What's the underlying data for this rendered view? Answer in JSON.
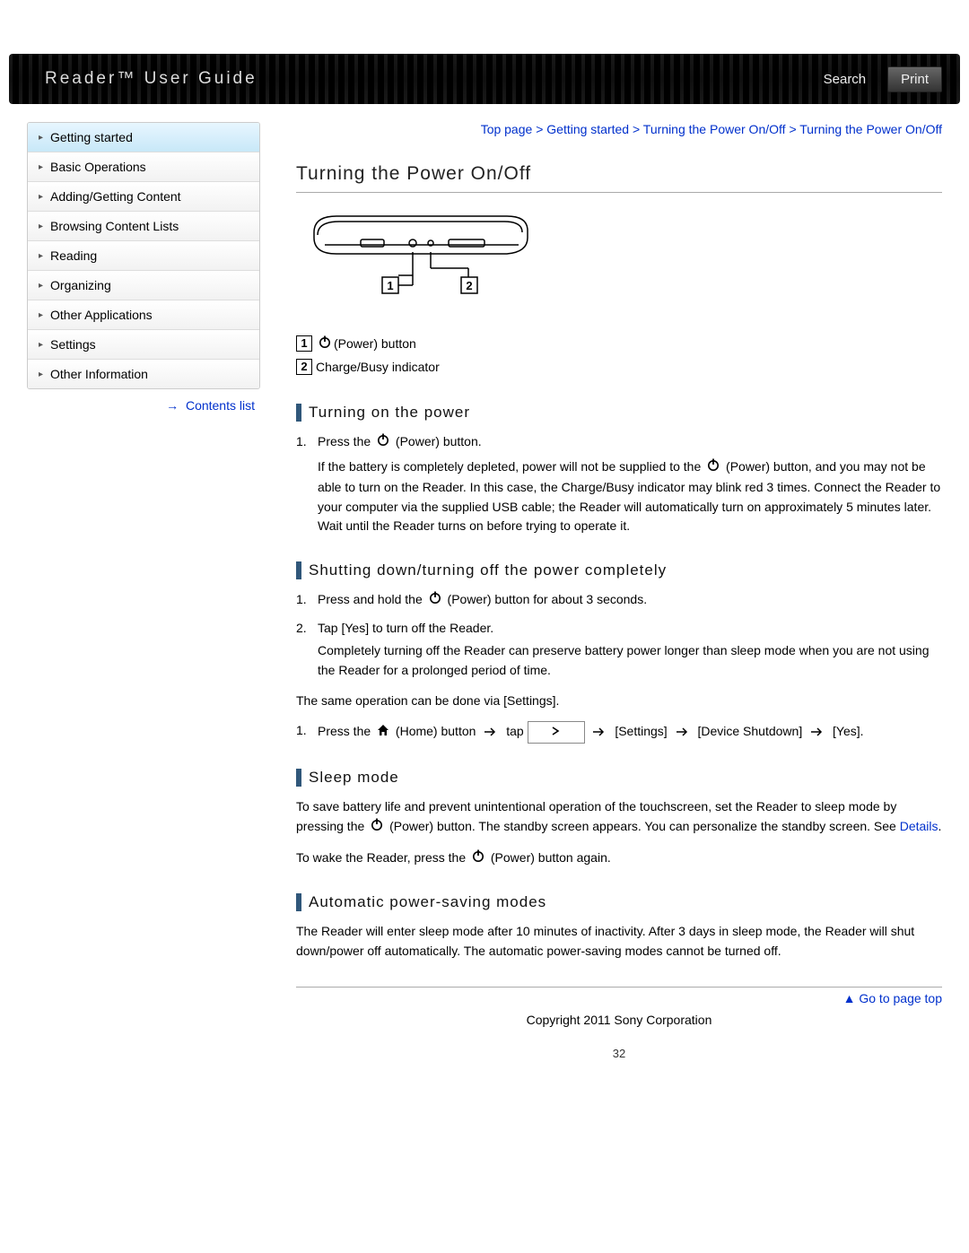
{
  "header": {
    "title": "Reader™ User Guide",
    "search_label": "Search",
    "print_label": "Print"
  },
  "sidebar": {
    "items": [
      {
        "label": "Getting started",
        "active": true
      },
      {
        "label": "Basic Operations"
      },
      {
        "label": "Adding/Getting Content"
      },
      {
        "label": "Browsing Content Lists"
      },
      {
        "label": "Reading"
      },
      {
        "label": "Organizing"
      },
      {
        "label": "Other Applications"
      },
      {
        "label": "Settings"
      },
      {
        "label": "Other Information"
      }
    ],
    "contents_list_label": "Contents list"
  },
  "breadcrumb": {
    "parts": [
      "Top page",
      "Getting started",
      "Turning the Power On/Off"
    ],
    "current": "Turning the Power On/Off",
    "sep": " > "
  },
  "page_title": "Turning the Power On/Off",
  "callouts": {
    "c1_text": "(Power) button",
    "c2_text": "Charge/Busy indicator"
  },
  "sections": {
    "turning_on": {
      "heading": "Turning on the power",
      "step1_a": "Press the ",
      "step1_b": "(Power) button.",
      "note": "If the battery is completely depleted, power will not be supplied to the ",
      "note_b": "(Power) button, and you may not be able to turn on the Reader. In this case, the Charge/Busy indicator may blink red 3 times. Connect the Reader to your computer via the supplied USB cable; the Reader will automatically turn on approximately 5 minutes later. Wait until the Reader turns on before trying to operate it."
    },
    "shutting": {
      "heading": "Shutting down/turning off the power completely",
      "step1_a": "Press and hold the ",
      "step1_b": "(Power) button for about 3 seconds.",
      "step2": "Tap [Yes] to turn off the Reader.",
      "step2_note": "Completely turning off the Reader can preserve battery power longer than sleep mode when you are not using the Reader for a prolonged period of time.",
      "via_settings": "The same operation can be done via [Settings].",
      "seq_a": "Press the ",
      "seq_home": "(Home) button",
      "seq_tap": "tap",
      "seq_settings": "[Settings]",
      "seq_shutdown": "[Device Shutdown]",
      "seq_yes": "[Yes]."
    },
    "sleep": {
      "heading": "Sleep mode",
      "p1_a": "To save battery life and prevent unintentional operation of the touchscreen, set the Reader to sleep mode by pressing the ",
      "p1_b": "(Power) button. The standby screen appears. You can personalize the standby screen. See ",
      "details": "Details",
      "p1_c": ".",
      "p2_a": "To wake the Reader, press the ",
      "p2_b": "(Power) button again."
    },
    "auto": {
      "heading": "Automatic power-saving modes",
      "p": "The Reader will enter sleep mode after 10 minutes of inactivity. After 3 days in sleep mode, the Reader will shut down/power off automatically. The automatic power-saving modes cannot be turned off."
    }
  },
  "footer": {
    "gotop": "Go to page top",
    "copyright": "Copyright 2011 Sony Corporation",
    "page_number": "32"
  },
  "icons": {
    "power": "power-icon",
    "home": "home-icon",
    "arrow_right": "arrow-right-icon",
    "arrow_up": "arrow-up-icon"
  }
}
